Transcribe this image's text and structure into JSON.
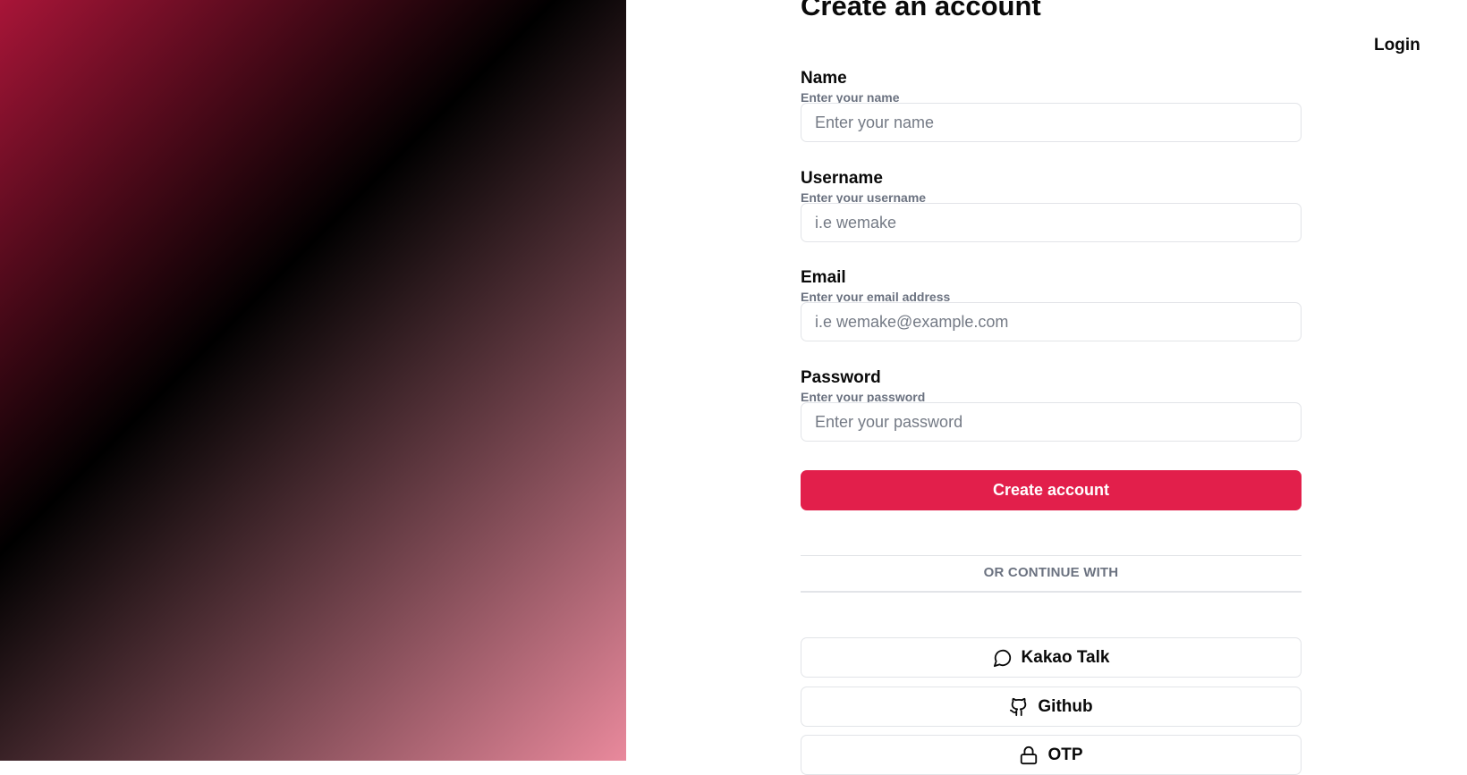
{
  "nav": {
    "login_label": "Login"
  },
  "form": {
    "title": "Create an account",
    "fields": [
      {
        "label": "Name",
        "hint": "Enter your name",
        "placeholder": "Enter your name"
      },
      {
        "label": "Username",
        "hint": "Enter your username",
        "placeholder": "i.e wemake"
      },
      {
        "label": "Email",
        "hint": "Enter your email address",
        "placeholder": "i.e wemake@example.com"
      },
      {
        "label": "Password",
        "hint": "Enter your password",
        "placeholder": "Enter your password"
      }
    ],
    "submit_label": "Create account"
  },
  "divider": {
    "text": "OR CONTINUE WITH"
  },
  "social": [
    {
      "label": "Kakao Talk",
      "icon": "message-circle-icon"
    },
    {
      "label": "Github",
      "icon": "github-icon"
    },
    {
      "label": "OTP",
      "icon": "lock-icon"
    }
  ],
  "colors": {
    "accent": "#e21f4b",
    "hero_gradient": [
      "#a81538",
      "#000000",
      "#e9899c"
    ]
  }
}
